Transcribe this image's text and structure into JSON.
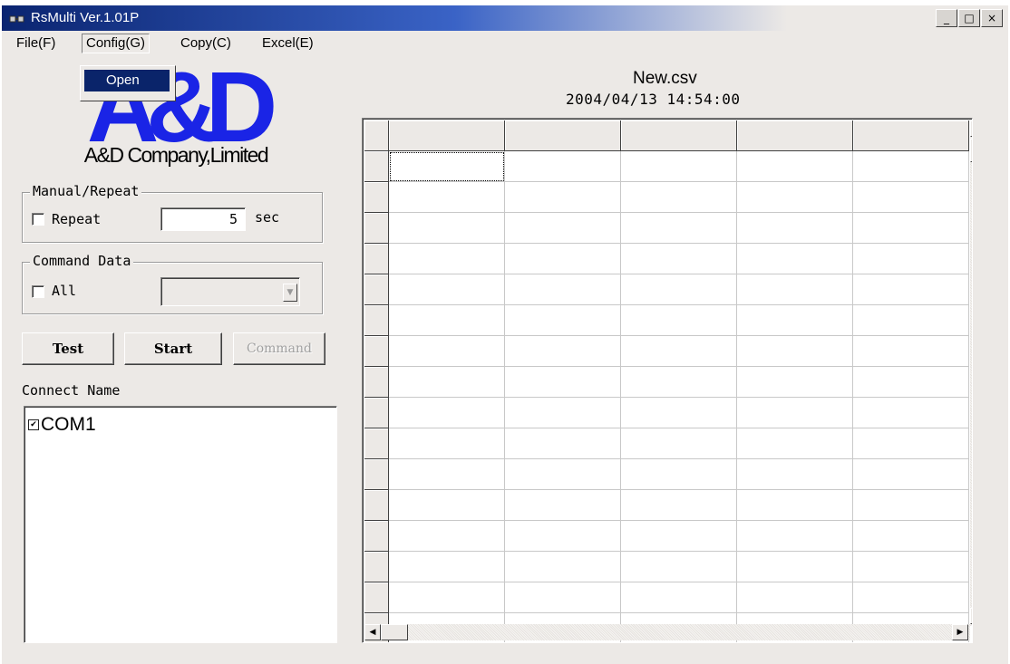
{
  "window": {
    "title": "RsMulti Ver.1.01P",
    "controls": [
      "_",
      "□",
      "×"
    ]
  },
  "menu": {
    "items": [
      {
        "label": "File(F)"
      },
      {
        "label": "Config(G)"
      },
      {
        "label": "Copy(C)"
      },
      {
        "label": "Excel(E)"
      }
    ],
    "dropdown": {
      "items": [
        {
          "label": "Open"
        }
      ]
    }
  },
  "logo": {
    "mark": "A&D",
    "subtitle": "A&D Company,Limited",
    "color": "#1a24e6"
  },
  "manual_repeat": {
    "label": "Manual/Repeat",
    "checkbox_label": "Repeat",
    "value": "5",
    "unit": "sec",
    "checked": false
  },
  "command_data": {
    "label": "Command Data",
    "checkbox_label": "All",
    "checked": false,
    "selected": ""
  },
  "buttons": {
    "test": "Test",
    "start": "Start",
    "command": "Command"
  },
  "connect": {
    "label": "Connect Name",
    "items": [
      {
        "label": "COM1",
        "checked": true
      }
    ]
  },
  "sheet": {
    "file_name": "New.csv",
    "timestamp": "2004/04/13 14:54:00"
  }
}
